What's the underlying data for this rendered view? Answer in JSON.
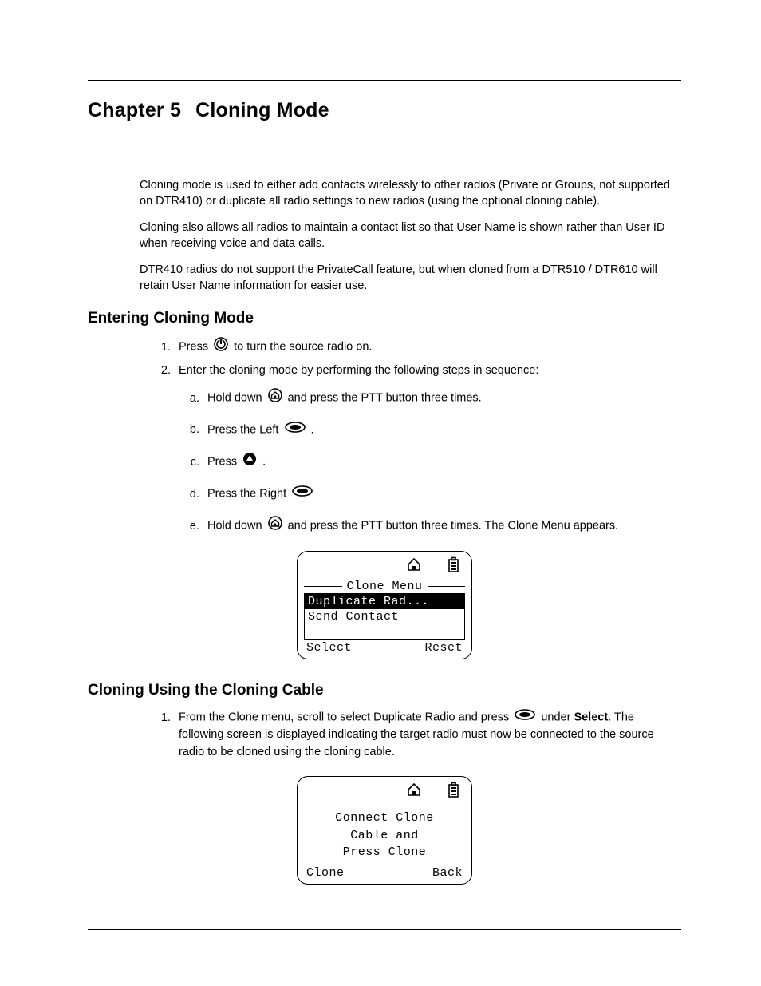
{
  "chapter": {
    "number": "Chapter 5",
    "title": "Cloning Mode"
  },
  "intro": {
    "p1": "Cloning mode is used to either add contacts wirelessly to other radios (Private or Groups, not supported on DTR410) or duplicate all radio settings to new radios (using the optional cloning cable).",
    "p2": "Cloning also allows all radios to maintain a contact list so that User Name is shown rather than User ID when receiving voice and data calls.",
    "p3": "DTR410 radios do not support the PrivateCall feature, but when cloned from a DTR510 / DTR610 will retain User Name information for easier use."
  },
  "section1": {
    "heading": "Entering Cloning Mode",
    "step1_a": "Press ",
    "step1_b": " to turn the source radio on.",
    "step2": "Enter the cloning mode by performing the following steps in sequence:",
    "sub_a_1": "Hold down ",
    "sub_a_2": " and press the PTT button three times.",
    "sub_b_1": "Press the Left ",
    "sub_b_2": ".",
    "sub_c_1": "Press ",
    "sub_c_2": ".",
    "sub_d_1": "Press the Right ",
    "sub_e_1": "Hold down ",
    "sub_e_2": " and press the PTT button three times. The Clone Menu appears."
  },
  "screen1": {
    "title": "Clone Menu",
    "item1": "Duplicate Rad...",
    "item2": "Send Contact",
    "soft_left": "Select",
    "soft_right": "Reset"
  },
  "section2": {
    "heading": "Cloning Using the Cloning Cable",
    "step1_a": "From the Clone menu, scroll to select Duplicate Radio and press ",
    "step1_b": " under ",
    "step1_bold": "Select",
    "step1_c": ". The following screen is displayed indicating the target radio must now be connected to the source radio to be cloned using the cloning cable."
  },
  "screen2": {
    "line1": "Connect Clone",
    "line2": "Cable and",
    "line3": "Press Clone",
    "soft_left": "Clone",
    "soft_right": "Back"
  }
}
